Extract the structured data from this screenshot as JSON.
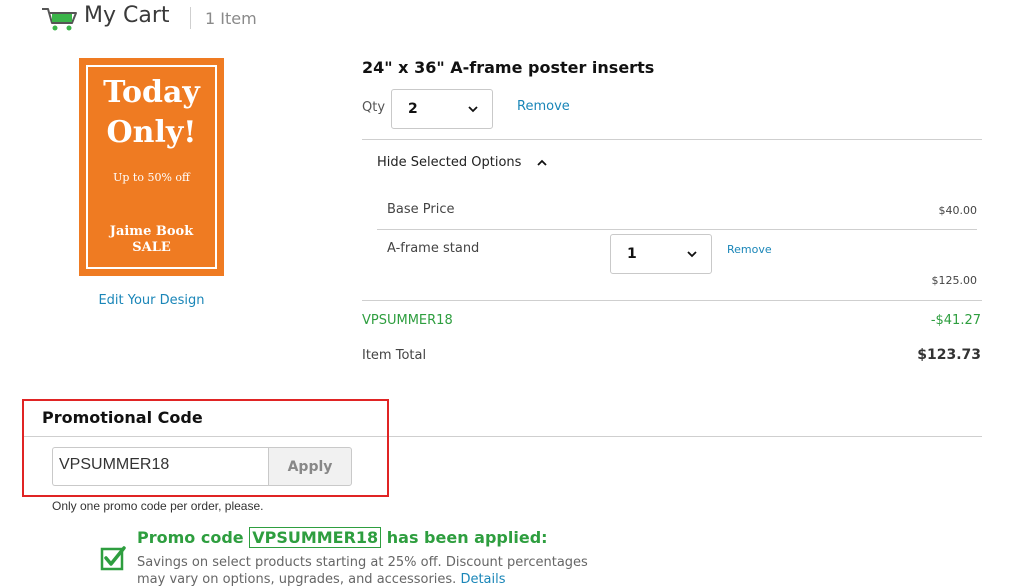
{
  "header": {
    "title": "My Cart",
    "item_count": "1 Item",
    "icon": "shopping-cart-icon",
    "icon_color": "#3bb54a"
  },
  "product": {
    "image": {
      "line1": "Today",
      "line2": "Only!",
      "line3": "Up to 50% off",
      "line4": "Jaime Book",
      "line5": "SALE",
      "bg_color": "#ef7b22"
    },
    "edit_link": "Edit Your Design",
    "title": "24\" x 36\" A-frame poster inserts",
    "qty_label": "Qty",
    "qty_value": "2",
    "remove_label": "Remove"
  },
  "options": {
    "toggle_label": "Hide Selected Options",
    "base_price_label": "Base Price",
    "base_price_value": "$40.00",
    "stand_label": "A-frame stand",
    "stand_qty": "1",
    "stand_remove": "Remove",
    "stand_price": "$125.00"
  },
  "summary": {
    "promo_label": "VPSUMMER18",
    "promo_discount": "-$41.27",
    "total_label": "Item Total",
    "total_value": "$123.73"
  },
  "promo": {
    "section_title": "Promotional Code",
    "input_value": "VPSUMMER18",
    "apply_label": "Apply",
    "note": "Only one promo code per order, please.",
    "applied_prefix": "Promo code",
    "applied_code": "VPSUMMER18",
    "applied_suffix": "has been applied:",
    "savings_text": "Savings on select products starting at 25% off. Discount percentages may vary on options, upgrades, and accessories.",
    "details_link": "Details",
    "highlight_color": "#e02424",
    "success_color": "#2e9e3f"
  }
}
